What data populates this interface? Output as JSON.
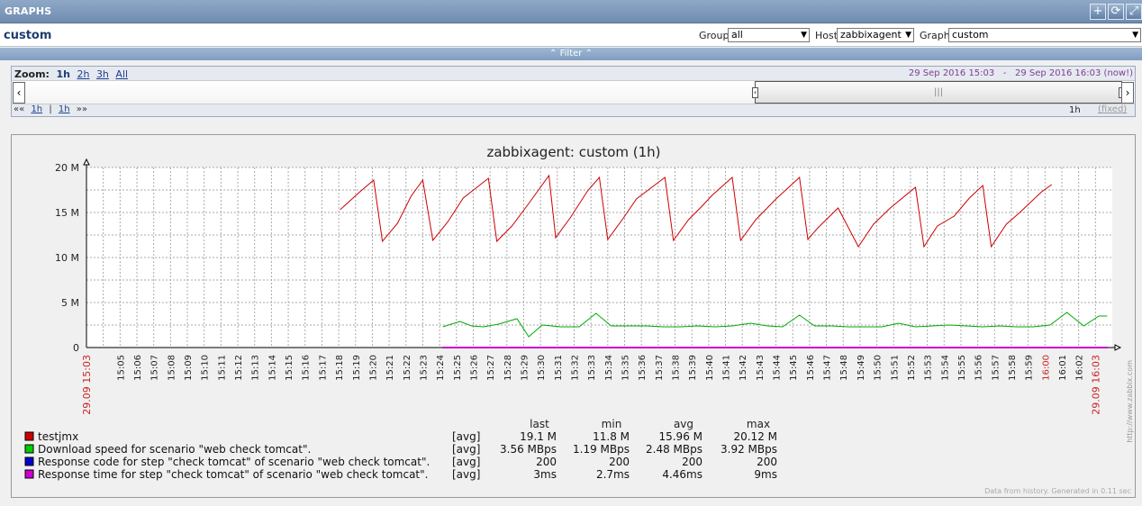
{
  "header": {
    "title": "GRAPHS",
    "buttons": [
      "plus-icon",
      "refresh-icon",
      "fullscreen-icon"
    ]
  },
  "title_row": {
    "page_title": "custom",
    "group_label": "Group",
    "group_value": "all",
    "host_label": "Host",
    "host_value": "zabbixagent",
    "graph_label": "Graph",
    "graph_value": "custom"
  },
  "filter": {
    "label": "Filter"
  },
  "zoom": {
    "label": "Zoom:",
    "options": [
      "1h",
      "2h",
      "3h",
      "All"
    ],
    "active": "1h",
    "range_from": "29 Sep 2016 15:03",
    "range_sep": "-",
    "range_to": "29 Sep 2016 16:03 (now!)",
    "nav_back": "««",
    "nav_back_step": "1h",
    "nav_fwd_step": "1h",
    "nav_fwd": "»»",
    "nav_sep": "|",
    "period": "1h",
    "fixed": "(fixed)"
  },
  "graph": {
    "watermark": "http://www.zabbix.com",
    "footer": "Data from history. Generated in 0.11 sec"
  },
  "chart_data": {
    "type": "line",
    "title": "zabbixagent: custom (1h)",
    "y_ticks": [
      "0",
      "5 M",
      "10 M",
      "15 M",
      "20 M"
    ],
    "ylim": [
      0,
      20000000
    ],
    "x_start_label": "29.09 15:03",
    "x_end_label": "29.09 16:03",
    "x_ticks": [
      "15:05",
      "15:06",
      "15:07",
      "15:08",
      "15:09",
      "15:10",
      "15:11",
      "15:12",
      "15:13",
      "15:14",
      "15:15",
      "15:16",
      "15:17",
      "15:18",
      "15:19",
      "15:20",
      "15:21",
      "15:22",
      "15:23",
      "15:24",
      "15:25",
      "15:26",
      "15:27",
      "15:28",
      "15:29",
      "15:30",
      "15:31",
      "15:32",
      "15:33",
      "15:34",
      "15:35",
      "15:36",
      "15:37",
      "15:38",
      "15:39",
      "15:40",
      "15:41",
      "15:42",
      "15:43",
      "15:44",
      "15:45",
      "15:46",
      "15:47",
      "15:48",
      "15:49",
      "15:50",
      "15:51",
      "15:52",
      "15:53",
      "15:54",
      "15:55",
      "15:56",
      "15:57",
      "15:58",
      "15:59",
      "16:00",
      "16:01",
      "16:02"
    ],
    "x_ticks_highlight": [
      "16:00"
    ],
    "grid": true,
    "series": [
      {
        "name": "testjmx",
        "color": "#cc0000",
        "points": [
          [
            15.08,
            15.3
          ],
          [
            16.2,
            17.2
          ],
          [
            17.08,
            18.6
          ],
          [
            17.6,
            11.8
          ],
          [
            18.5,
            13.8
          ],
          [
            19.3,
            16.8
          ],
          [
            20.0,
            18.6
          ],
          [
            20.6,
            11.9
          ],
          [
            21.5,
            14.0
          ],
          [
            22.4,
            16.6
          ],
          [
            23.9,
            18.8
          ],
          [
            24.4,
            11.8
          ],
          [
            25.3,
            13.5
          ],
          [
            26.3,
            16.0
          ],
          [
            27.5,
            19.1
          ],
          [
            27.9,
            12.2
          ],
          [
            28.8,
            14.5
          ],
          [
            29.8,
            17.4
          ],
          [
            30.5,
            18.9
          ],
          [
            31.0,
            12.0
          ],
          [
            31.9,
            14.3
          ],
          [
            32.7,
            16.5
          ],
          [
            34.4,
            18.9
          ],
          [
            34.9,
            11.9
          ],
          [
            35.8,
            14.2
          ],
          [
            36.6,
            15.7
          ],
          [
            37.2,
            16.9
          ],
          [
            38.4,
            18.9
          ],
          [
            38.9,
            11.9
          ],
          [
            39.8,
            14.2
          ],
          [
            41.0,
            16.5
          ],
          [
            42.4,
            18.9
          ],
          [
            42.9,
            12.0
          ],
          [
            43.5,
            13.3
          ],
          [
            44.7,
            15.5
          ],
          [
            45.9,
            11.2
          ],
          [
            46.8,
            13.7
          ],
          [
            47.8,
            15.5
          ],
          [
            49.3,
            17.8
          ],
          [
            49.8,
            11.2
          ],
          [
            50.6,
            13.5
          ],
          [
            51.6,
            14.6
          ],
          [
            52.5,
            16.6
          ],
          [
            53.3,
            18.0
          ],
          [
            53.8,
            11.2
          ],
          [
            54.7,
            13.7
          ],
          [
            55.5,
            15.0
          ],
          [
            56.8,
            17.3
          ],
          [
            57.4,
            18.1
          ]
        ]
      },
      {
        "name": "Download speed for scenario \"web check tomcat\".",
        "color": "#00aa00",
        "points": [
          [
            21.2,
            2.3
          ],
          [
            22.2,
            2.9
          ],
          [
            22.9,
            2.4
          ],
          [
            23.6,
            2.3
          ],
          [
            24.5,
            2.6
          ],
          [
            25.6,
            3.2
          ],
          [
            26.3,
            1.2
          ],
          [
            27.1,
            2.5
          ],
          [
            28.2,
            2.3
          ],
          [
            29.3,
            2.3
          ],
          [
            30.3,
            3.8
          ],
          [
            31.2,
            2.4
          ],
          [
            32.3,
            2.4
          ],
          [
            33.3,
            2.4
          ],
          [
            34.3,
            2.3
          ],
          [
            35.3,
            2.3
          ],
          [
            36.3,
            2.4
          ],
          [
            37.4,
            2.3
          ],
          [
            38.4,
            2.4
          ],
          [
            39.5,
            2.7
          ],
          [
            40.5,
            2.4
          ],
          [
            41.4,
            2.3
          ],
          [
            42.4,
            3.6
          ],
          [
            43.3,
            2.4
          ],
          [
            44.3,
            2.4
          ],
          [
            45.3,
            2.3
          ],
          [
            46.3,
            2.3
          ],
          [
            47.3,
            2.3
          ],
          [
            48.3,
            2.7
          ],
          [
            49.3,
            2.3
          ],
          [
            50.3,
            2.4
          ],
          [
            51.3,
            2.5
          ],
          [
            52.3,
            2.4
          ],
          [
            53.3,
            2.3
          ],
          [
            54.3,
            2.4
          ],
          [
            55.3,
            2.3
          ],
          [
            56.3,
            2.3
          ],
          [
            57.3,
            2.5
          ],
          [
            58.3,
            3.9
          ],
          [
            59.3,
            2.4
          ],
          [
            60.2,
            3.5
          ],
          [
            60.7,
            3.5
          ]
        ]
      },
      {
        "name": "Response code for step \"check tomcat\" of scenario \"web check tomcat\".",
        "color": "#0000cc",
        "points": [
          [
            21.2,
            0.0002
          ],
          [
            60.7,
            0.0002
          ]
        ]
      },
      {
        "name": "Response time for step \"check tomcat\" of scenario \"web check tomcat\".",
        "color": "#cc00cc",
        "points": [
          [
            21.2,
            0.0
          ],
          [
            60.7,
            0.0
          ]
        ]
      }
    ],
    "y_unit_multiplier": 1000000,
    "legend": {
      "columns": [
        "last",
        "min",
        "avg",
        "max"
      ],
      "rows": [
        {
          "name": "testjmx",
          "func": "[avg]",
          "last": "19.1 M",
          "min": "11.8 M",
          "avg": "15.96 M",
          "max": "20.12 M",
          "color": "#cc0000"
        },
        {
          "name": "Download speed for scenario \"web check tomcat\".",
          "func": "[avg]",
          "last": "3.56 MBps",
          "min": "1.19 MBps",
          "avg": "2.48 MBps",
          "max": "3.92 MBps",
          "color": "#00cc00"
        },
        {
          "name": "Response code for step \"check tomcat\" of scenario \"web check tomcat\".",
          "func": "[avg]",
          "last": "200",
          "min": "200",
          "avg": "200",
          "max": "200",
          "color": "#0000cc"
        },
        {
          "name": "Response time for step \"check tomcat\" of scenario \"web check tomcat\".",
          "func": "[avg]",
          "last": "3ms",
          "min": "2.7ms",
          "avg": "4.46ms",
          "max": "9ms",
          "color": "#cc00cc"
        }
      ]
    }
  }
}
